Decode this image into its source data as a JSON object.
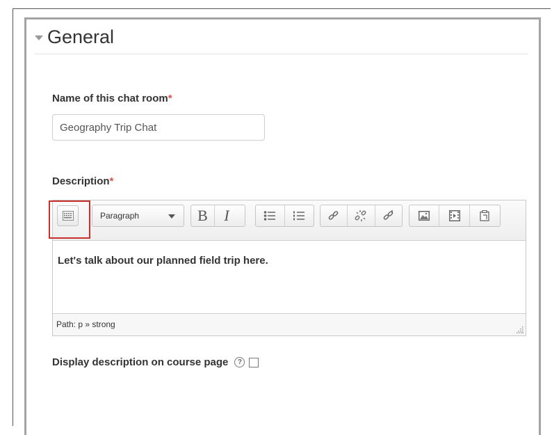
{
  "section": {
    "title": "General"
  },
  "name_field": {
    "label": "Name of this chat room",
    "required_mark": "*",
    "value": "Geography Trip Chat"
  },
  "description": {
    "label": "Description",
    "required_mark": "*",
    "toolbar": {
      "format_select": "Paragraph",
      "bold": "B",
      "italic": "I",
      "icons": [
        "kitchen-sink-icon",
        "bold-icon",
        "italic-icon",
        "bullet-list-icon",
        "numbered-list-icon",
        "link-icon",
        "unlink-icon",
        "anchor-icon",
        "image-icon",
        "media-icon",
        "paste-icon"
      ]
    },
    "content": "Let's talk about our planned field trip here.",
    "path": "Path: p » strong"
  },
  "display_option": {
    "label": "Display description on course page",
    "help": "?"
  },
  "colors": {
    "required": "#d9534f",
    "highlight": "#c9302c"
  }
}
